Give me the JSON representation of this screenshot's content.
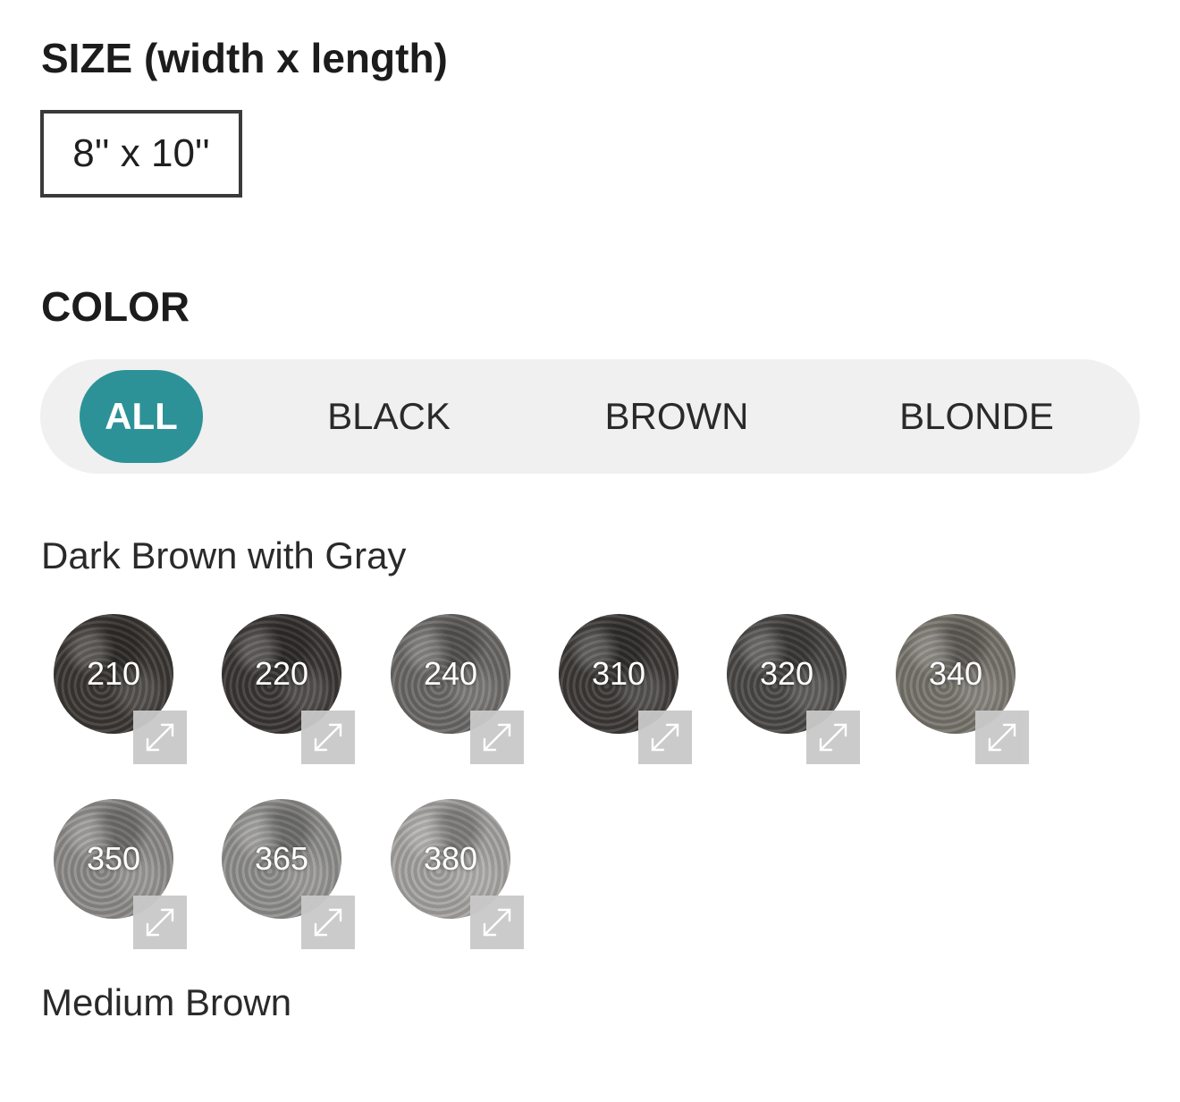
{
  "size": {
    "title": "SIZE (width x length)",
    "selected_option": "8'' x 10''"
  },
  "color": {
    "title": "COLOR",
    "filters": [
      {
        "label": "ALL",
        "active": true
      },
      {
        "label": "BLACK",
        "active": false
      },
      {
        "label": "BROWN",
        "active": false
      },
      {
        "label": "BLONDE",
        "active": false
      }
    ],
    "accent_color": "#2d9298",
    "groups": [
      {
        "name": "Dark Brown with Gray",
        "swatches": [
          {
            "code": "210",
            "tone": "#3b3733"
          },
          {
            "code": "220",
            "tone": "#3a3634"
          },
          {
            "code": "240",
            "tone": "#6a6866"
          },
          {
            "code": "310",
            "tone": "#3c3937"
          },
          {
            "code": "320",
            "tone": "#4a4846"
          },
          {
            "code": "340",
            "tone": "#77736c"
          },
          {
            "code": "350",
            "tone": "#8d8b89"
          },
          {
            "code": "365",
            "tone": "#8f8e8c"
          },
          {
            "code": "380",
            "tone": "#a4a3a1"
          }
        ]
      },
      {
        "name": "Medium Brown",
        "swatches": []
      }
    ],
    "zoom_icon": "expand-icon"
  }
}
